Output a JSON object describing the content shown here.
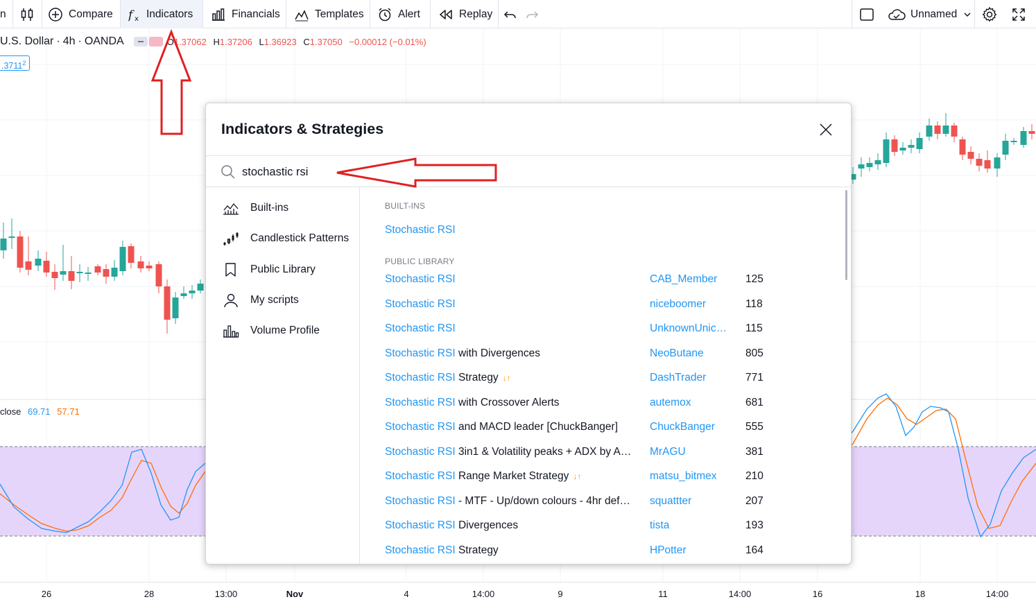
{
  "toolbar": {
    "left_fragment": "n",
    "compare": "Compare",
    "indicators": "Indicators",
    "financials": "Financials",
    "templates": "Templates",
    "alert": "Alert",
    "replay": "Replay",
    "layout_name": "Unnamed"
  },
  "symbol": {
    "name": "U.S. Dollar",
    "interval": "4h",
    "exchange": "OANDA",
    "open_label": "O",
    "open": "1.37062",
    "high_label": "H",
    "high": "1.37206",
    "low_label": "L",
    "low": "1.36923",
    "close_label": "C",
    "close": "1.37050",
    "change": "−0.00012 (−0.01%)",
    "price_badge": ".3711",
    "price_badge_sup": "2"
  },
  "oscillator": {
    "label": "close",
    "k": "69.71",
    "d": "57.71"
  },
  "time_axis": [
    "26",
    "28",
    "13:00",
    "Nov",
    "4",
    "14:00",
    "9",
    "11",
    "14:00",
    "16",
    "18",
    "14:00"
  ],
  "dialog": {
    "title": "Indicators & Strategies",
    "search_value": "stochastic rsi",
    "sidebar": [
      {
        "label": "Built-ins",
        "icon": "built-ins-icon"
      },
      {
        "label": "Candlestick Patterns",
        "icon": "candlestick-patterns-icon"
      },
      {
        "label": "Public Library",
        "icon": "bookmark-icon"
      },
      {
        "label": "My scripts",
        "icon": "user-icon"
      },
      {
        "label": "Volume Profile",
        "icon": "volume-profile-icon"
      }
    ],
    "builtins_header": "BUILT-INS",
    "builtins": [
      {
        "name": "Stochastic RSI"
      }
    ],
    "public_header": "PUBLIC LIBRARY",
    "public": [
      {
        "hl": "Stochastic RSI",
        "rest": "",
        "author": "CAB_Member",
        "count": "125",
        "badge": ""
      },
      {
        "hl": "Stochastic RSI",
        "rest": "",
        "author": "niceboomer",
        "count": "118",
        "badge": ""
      },
      {
        "hl": "Stochastic RSI",
        "rest": "",
        "author": "UnknownUnic…",
        "count": "115",
        "badge": ""
      },
      {
        "hl": "Stochastic RSI",
        "rest": " with Divergences",
        "author": "NeoButane",
        "count": "805",
        "badge": ""
      },
      {
        "hl": "Stochastic RSI",
        "rest": " Strategy",
        "author": "DashTrader",
        "count": "771",
        "badge": "↓↑"
      },
      {
        "hl": "Stochastic RSI",
        "rest": " with Crossover Alerts",
        "author": "autemox",
        "count": "681",
        "badge": ""
      },
      {
        "hl": "Stochastic RSI",
        "rest": " and MACD leader [ChuckBanger]",
        "author": "ChuckBanger",
        "count": "555",
        "badge": ""
      },
      {
        "hl": "Stochastic RSI",
        "rest": " 3in1 & Volatility peaks + ADX by A…",
        "author": "MrAGU",
        "count": "381",
        "badge": ""
      },
      {
        "hl": "Stochastic RSI",
        "rest": " Range Market Strategy",
        "author": "matsu_bitmex",
        "count": "210",
        "badge": "↓↑"
      },
      {
        "hl": "Stochastic RSI",
        "rest": " - MTF - Up/down colours - 4hr def…",
        "author": "squattter",
        "count": "207",
        "badge": ""
      },
      {
        "hl": "Stochastic RSI",
        "rest": " Divergences",
        "author": "tista",
        "count": "193",
        "badge": ""
      },
      {
        "hl": "Stochastic RSI",
        "rest": " Strategy",
        "author": "HPotter",
        "count": "164",
        "badge": ""
      }
    ]
  },
  "colors": {
    "accent": "#2196f3",
    "up": "#26a69a",
    "down": "#ef5350",
    "band": "#e6d5fb",
    "annotation": "#e02020"
  }
}
